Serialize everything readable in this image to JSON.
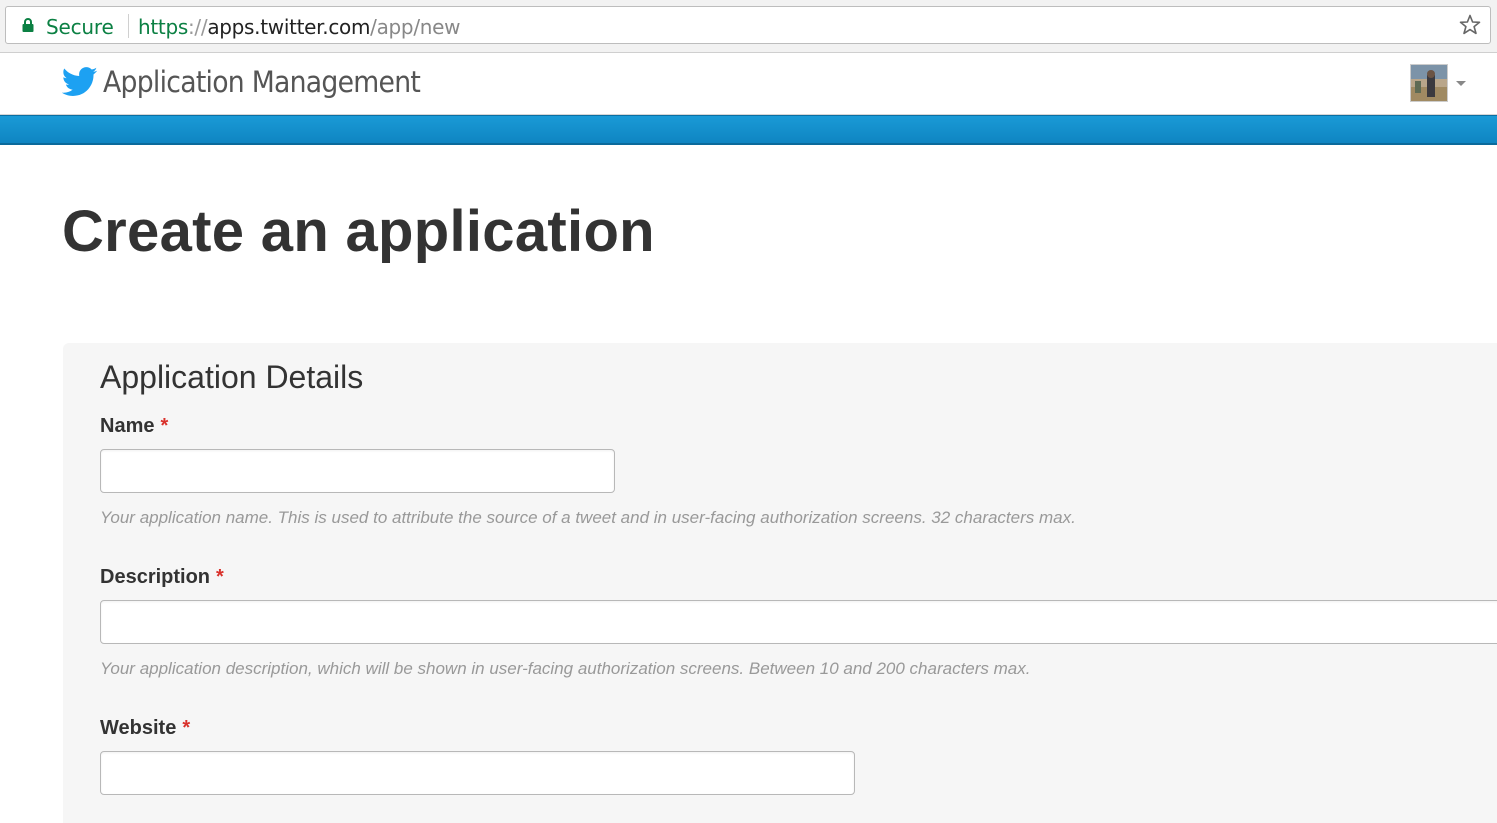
{
  "browser": {
    "secure_label": "Secure",
    "url_scheme": "https",
    "url_separator": "://",
    "url_host": "apps.twitter.com",
    "url_path": "/app/new",
    "secure_color": "#0b8043"
  },
  "header": {
    "title": "Application Management",
    "brand_color": "#1da1f2"
  },
  "page": {
    "title": "Create an application"
  },
  "details": {
    "section_title": "Application Details",
    "required_marker": "*",
    "fields": [
      {
        "label": "Name",
        "value": "",
        "help": "Your application name. This is used to attribute the source of a tweet and in user-facing authorization screens. 32 characters max."
      },
      {
        "label": "Description",
        "value": "",
        "help": "Your application description, which will be shown in user-facing authorization screens. Between 10 and 200 characters max."
      },
      {
        "label": "Website",
        "value": ""
      }
    ]
  }
}
